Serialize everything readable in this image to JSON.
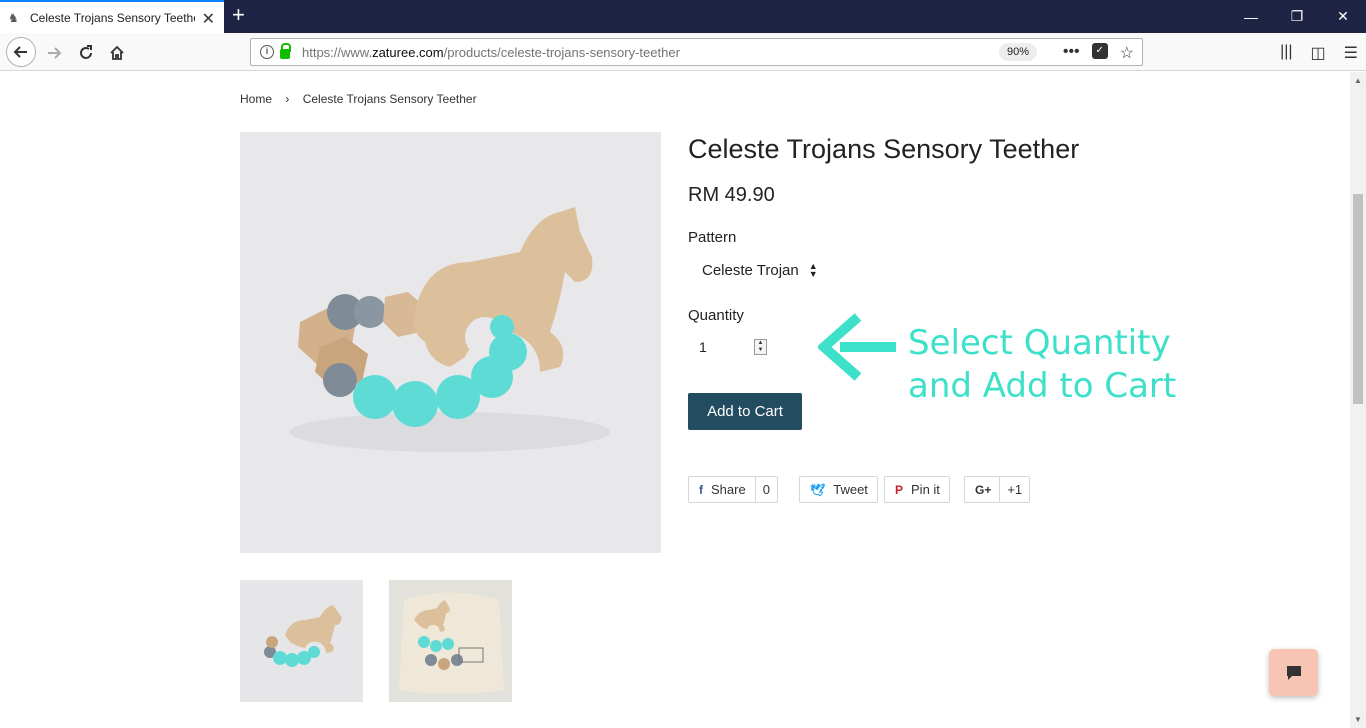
{
  "browser": {
    "tab_title": "Celeste Trojans Sensory Teether",
    "url_prefix": "https://www.",
    "url_host": "zaturee.com",
    "url_path": "/products/celeste-trojans-sensory-teether",
    "zoom": "90%"
  },
  "breadcrumb": {
    "home": "Home",
    "separator": "›",
    "current": "Celeste Trojans Sensory Teether"
  },
  "product": {
    "title": "Celeste Trojans Sensory Teether",
    "price": "RM 49.90",
    "pattern_label": "Pattern",
    "pattern_value": "Celeste Trojan",
    "quantity_label": "Quantity",
    "quantity_value": "1",
    "add_to_cart": "Add to Cart"
  },
  "annotation": {
    "line1": "Select Quantity",
    "line2": "and Add to Cart",
    "color": "#3de0c8"
  },
  "social": {
    "share_label": "Share",
    "share_count": "0",
    "tweet_label": "Tweet",
    "pin_label": "Pin it",
    "gplus_label": "G+",
    "gplus_count": "+1"
  },
  "colors": {
    "button": "#224c60",
    "titlebar": "#1f2445",
    "chat": "#f8c5b4"
  }
}
